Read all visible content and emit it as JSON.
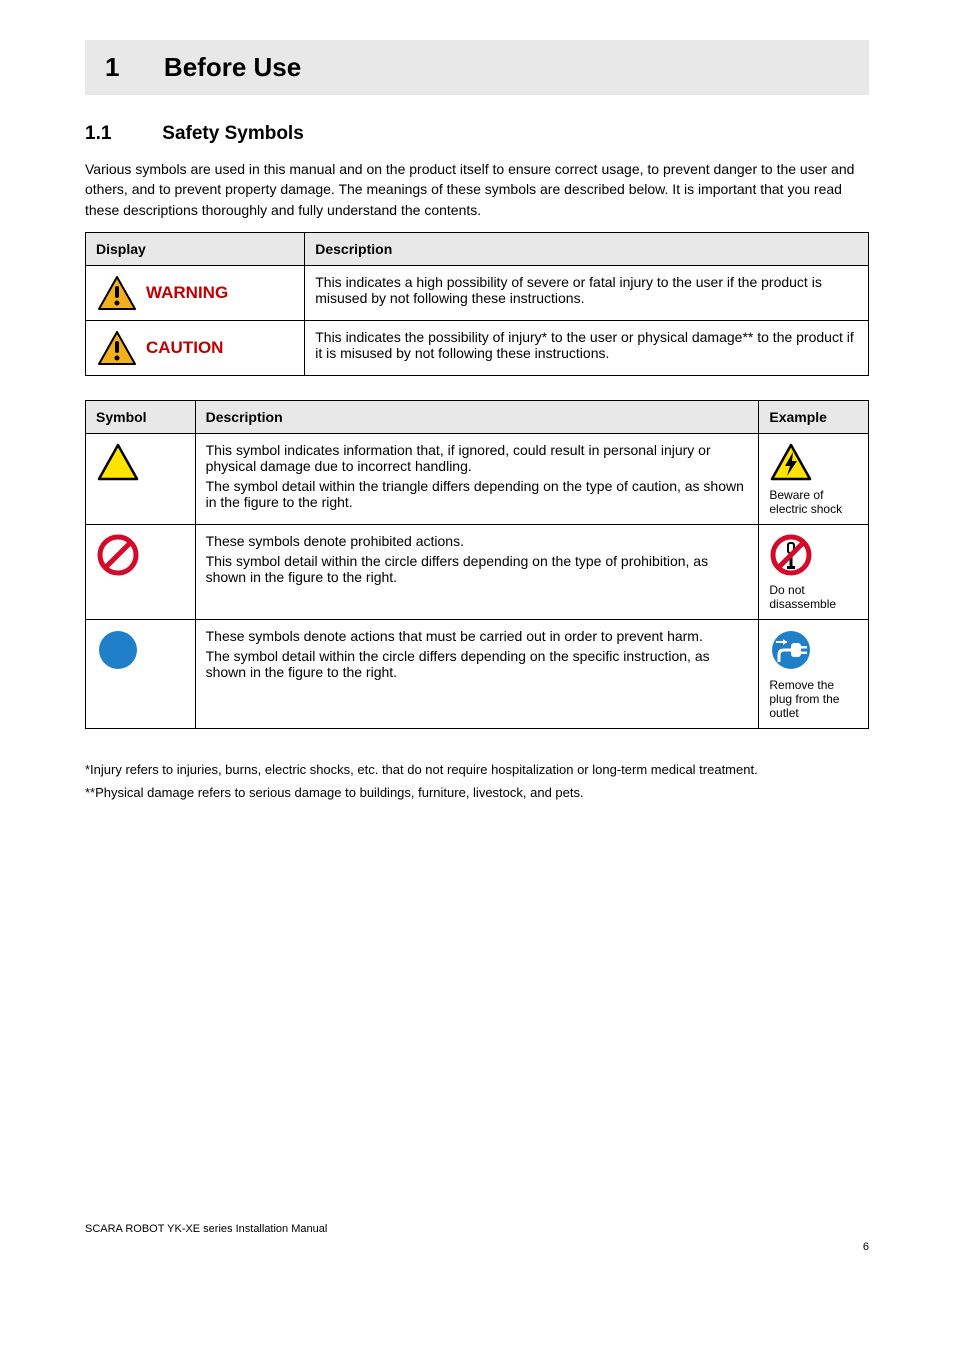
{
  "chapter": {
    "number": "1",
    "title": "Before Use"
  },
  "section": {
    "number": "1.1",
    "title": "Safety Symbols"
  },
  "intro": "Various symbols are used in this manual and on the product itself to ensure correct usage, to prevent danger to the user and others, and to prevent property damage. The meanings of these symbols are described below. It is important that you read these descriptions thoroughly and fully understand the contents.",
  "table1": {
    "headers": {
      "display": "Display",
      "description": "Description"
    },
    "rows": [
      {
        "label": "WARNING",
        "desc": "This indicates a high possibility of severe or fatal injury to the user if the product is misused by not following these instructions."
      },
      {
        "label": "CAUTION",
        "desc": "This indicates the possibility of injury* to the user or physical damage** to the product if it is misused by not following these instructions."
      }
    ]
  },
  "table2": {
    "headers": {
      "symbol": "Symbol",
      "description": "Description",
      "example": "Example"
    },
    "rows": [
      {
        "symbolCaption": "",
        "desc1": "This symbol indicates information that, if ignored, could result in personal injury or physical damage due to incorrect handling.",
        "desc2": "The symbol detail within the triangle differs depending on the type of caution, as shown in the figure to the right.",
        "exCaption": "Beware of electric shock"
      },
      {
        "symbolCaption": "",
        "desc1": "These symbols denote prohibited actions.",
        "desc2": "This symbol detail within the circle differs depending on the type of prohibition, as shown in the figure to the right.",
        "exCaption": "Do not disassemble"
      },
      {
        "symbolCaption": "",
        "desc1": "These symbols denote actions that must be carried out in order to prevent harm.",
        "desc2": "The symbol detail within the circle differs depending on the specific instruction, as shown in the figure to the right.",
        "exCaption": "Remove the plug from the outlet"
      }
    ]
  },
  "notes": [
    "*Injury refers to injuries, burns, electric shocks, etc. that do not require hospitalization or long-term medical treatment.",
    "**Physical damage refers to serious damage to buildings, furniture, livestock, and pets."
  ],
  "footer": "SCARA ROBOT YK-XE series Installation Manual",
  "pageNumber": "6"
}
